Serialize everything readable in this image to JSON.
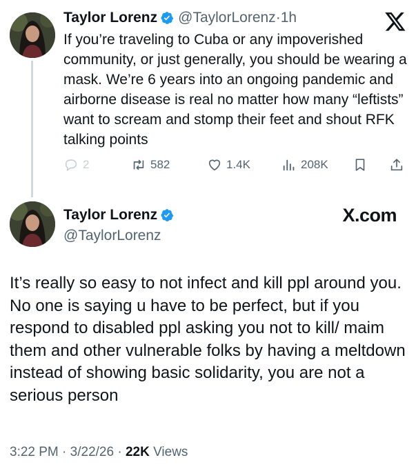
{
  "tweet1": {
    "name": "Taylor Lorenz",
    "handle": "@TaylorLorenz",
    "separator": "·",
    "time": "1h",
    "text": "If you’re traveling to Cuba or any impoverished community, or just generally, you should be wearing a mask. We’re 6 years into an ongoing pandemic and airborne disease is real no matter how many “leftists” want to scream and stomp their feet and shout RFK talking points",
    "replies": "2",
    "reposts": "582",
    "likes": "1.4K",
    "views": "208K"
  },
  "tweet2": {
    "name": "Taylor Lorenz",
    "handle": "@TaylorLorenz",
    "brand": "X.com",
    "text": "It’s really so easy to not infect and kill ppl around you. No one is saying u have to be perfect, but if you respond to disabled ppl asking you not to kill/ maim them and other vulnerable folks by having a meltdown instead of showing basic solidarity, you are not a serious person",
    "time": "3:22 PM",
    "separator1": "·",
    "date": "3/22/26",
    "separator2": "·",
    "views_count": "22K",
    "views_label": "Views"
  },
  "icons": {
    "verified": "verified-badge-icon",
    "x_logo": "x-logo-icon",
    "reply": "reply-icon",
    "repost": "repost-icon",
    "like": "heart-icon",
    "views": "views-chart-icon",
    "bookmark": "bookmark-icon",
    "share": "share-icon"
  },
  "colors": {
    "text": "#0f1419",
    "secondary": "#536471",
    "verified_blue": "#1d9bf0",
    "thread_line": "#cfd9de"
  }
}
